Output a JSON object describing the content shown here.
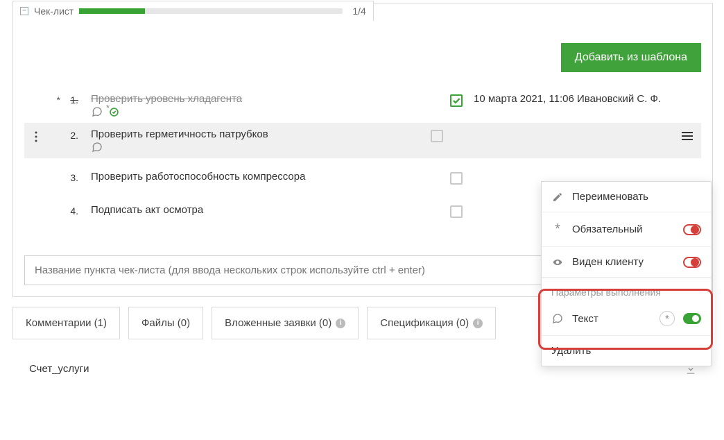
{
  "header": {
    "title": "Чек-лист",
    "progress_text": "1/4",
    "progress_pct": 25
  },
  "actions": {
    "add_from_template": "Добавить из шаблона"
  },
  "items": [
    {
      "num": "1.",
      "mark": "*",
      "title": "Проверить уровень хладагента",
      "done": true,
      "meta": "10 марта 2021, 11:06 Ивановский С. Ф.",
      "has_comment_ast": true
    },
    {
      "num": "2.",
      "title": "Проверить герметичность патрубков",
      "done": false,
      "selected": true
    },
    {
      "num": "3.",
      "title": "Проверить работоспособность компрессора",
      "done": false
    },
    {
      "num": "4.",
      "title": "Подписать акт осмотра",
      "done": false
    }
  ],
  "add_input": {
    "placeholder": "Название пункта чек-листа (для ввода нескольких строк используйте ctrl + enter)"
  },
  "tabs": {
    "comments": "Комментарии (1)",
    "files": "Файлы (0)",
    "nested": "Вложенные заявки (0)",
    "spec": "Спецификация (0)"
  },
  "bottom": {
    "name": "Счет_услуги"
  },
  "ctx": {
    "rename": "Переименовать",
    "required": "Обязательный",
    "client_visible": "Виден клиенту",
    "exec_params": "Параметры выполнения",
    "text": "Текст",
    "delete": "Удалить"
  }
}
